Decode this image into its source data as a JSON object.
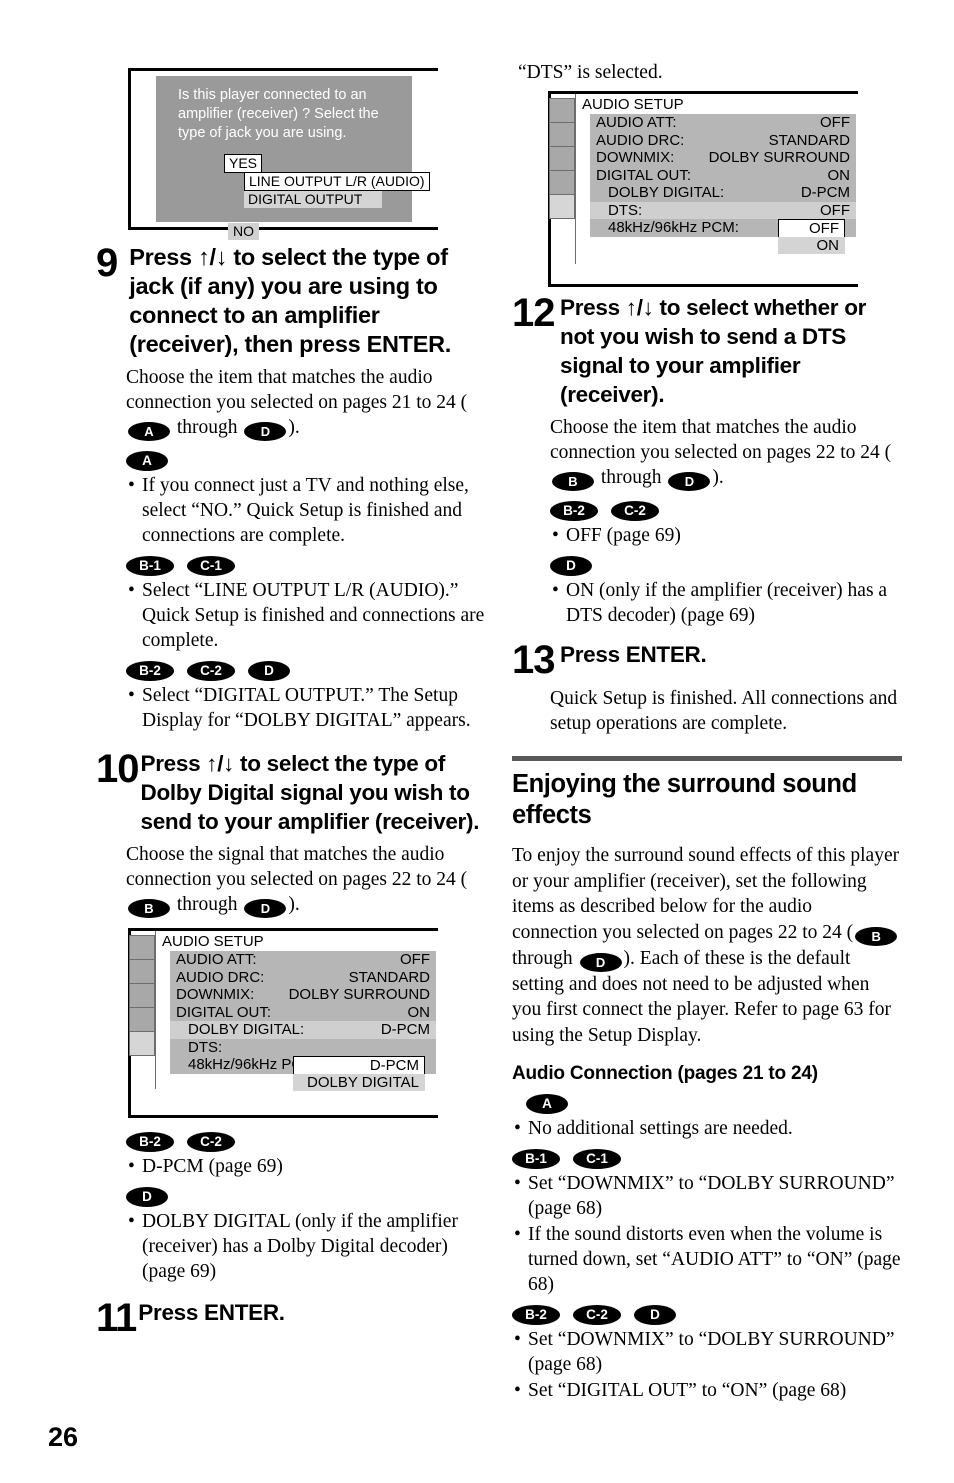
{
  "page": {
    "number": "26"
  },
  "figure_dialog": {
    "question": "Is this player connected to an amplifier (receiver) ? Select the type of jack you are using.",
    "options": {
      "yes": "YES",
      "line_output": "LINE OUTPUT L/R (AUDIO)",
      "digital_output": "DIGITAL OUTPUT",
      "no": "NO"
    }
  },
  "step9": {
    "number": "9",
    "title": "Press ↑/↓ to select the type of jack (if any) you are using to connect to an amplifier (receiver), then press ENTER.",
    "body": "Choose the item that matches the audio connection you selected on pages 21 to 24 (",
    "body_mid": " through ",
    "body_end": ").",
    "badge_from": "A",
    "badge_to": "D",
    "groups": [
      {
        "badges": [
          "A"
        ],
        "bullets": [
          "If you connect just a TV and nothing else, select “NO.” Quick Setup is finished and connections are complete."
        ]
      },
      {
        "badges": [
          "B-1",
          "C-1"
        ],
        "bullets": [
          "Select “LINE OUTPUT L/R (AUDIO).” Quick Setup is finished and connections are complete."
        ]
      },
      {
        "badges": [
          "B-2",
          "C-2",
          "D"
        ],
        "bullets": [
          "Select “DIGITAL OUTPUT.” The Setup Display for “DOLBY DIGITAL” appears."
        ]
      }
    ]
  },
  "step10": {
    "number": "10",
    "title": "Press ↑/↓ to select the type of Dolby Digital signal you wish to send to your amplifier (receiver).",
    "body": "Choose the signal that matches the audio connection you selected on pages 22 to 24 (",
    "body_mid": " through ",
    "body_end": ").",
    "badge_from": "B",
    "badge_to": "D",
    "groups": [
      {
        "badges": [
          "B-2",
          "C-2"
        ],
        "bullets": [
          "D-PCM (page 69)"
        ]
      },
      {
        "badges": [
          "D"
        ],
        "bullets": [
          "DOLBY DIGITAL (only if the amplifier (receiver) has a Dolby Digital decoder) (page 69)"
        ]
      }
    ]
  },
  "step11": {
    "number": "11",
    "title": "Press ENTER."
  },
  "setup_left": {
    "title": "AUDIO SETUP",
    "rows": [
      {
        "key": "AUDIO ATT:",
        "value": "OFF",
        "indent": false,
        "highlight": false
      },
      {
        "key": "AUDIO DRC:",
        "value": "STANDARD",
        "indent": false,
        "highlight": false
      },
      {
        "key": "DOWNMIX:",
        "value": "DOLBY SURROUND",
        "indent": false,
        "highlight": false
      },
      {
        "key": "DIGITAL OUT:",
        "value": "ON",
        "indent": false,
        "highlight": false
      },
      {
        "key": "DOLBY DIGITAL:",
        "value": "D-PCM",
        "indent": true,
        "highlight": true
      },
      {
        "key": "DTS:",
        "value": "",
        "indent": true,
        "highlight": false
      },
      {
        "key": "48kHz/96kHz PCM:",
        "value": "",
        "indent": true,
        "highlight": false
      }
    ],
    "popup": {
      "selected": "D-PCM",
      "other": "DOLBY DIGITAL"
    }
  },
  "caption_right": "“DTS” is selected.",
  "setup_right": {
    "title": "AUDIO SETUP",
    "rows": [
      {
        "key": "AUDIO ATT:",
        "value": "OFF",
        "indent": false,
        "highlight": false
      },
      {
        "key": "AUDIO DRC:",
        "value": "STANDARD",
        "indent": false,
        "highlight": false
      },
      {
        "key": "DOWNMIX:",
        "value": "DOLBY SURROUND",
        "indent": false,
        "highlight": false
      },
      {
        "key": "DIGITAL OUT:",
        "value": "ON",
        "indent": false,
        "highlight": false
      },
      {
        "key": "DOLBY DIGITAL:",
        "value": "D-PCM",
        "indent": true,
        "highlight": false
      },
      {
        "key": "DTS:",
        "value": "OFF",
        "indent": true,
        "highlight": true
      },
      {
        "key": "48kHz/96kHz PCM:",
        "value": "",
        "indent": true,
        "highlight": false
      }
    ],
    "popup": {
      "selected": "OFF",
      "other": "ON"
    }
  },
  "step12": {
    "number": "12",
    "title": "Press ↑/↓ to select whether or not you wish to send a DTS signal to your amplifier (receiver).",
    "body": "Choose the item that matches the audio connection you selected on pages 22 to 24 (",
    "body_mid": " through ",
    "body_end": ").",
    "badge_from": "B",
    "badge_to": "D",
    "groups": [
      {
        "badges": [
          "B-2",
          "C-2"
        ],
        "bullets": [
          "OFF (page 69)"
        ]
      },
      {
        "badges": [
          "D"
        ],
        "bullets": [
          "ON (only if the amplifier (receiver)  has a DTS decoder) (page 69)"
        ]
      }
    ]
  },
  "step13": {
    "number": "13",
    "title": "Press ENTER.",
    "body": "Quick Setup is finished. All connections and setup operations are complete."
  },
  "section": {
    "heading": "Enjoying the surround sound effects",
    "lead_a": "To enjoy the surround sound effects of this player or your amplifier (receiver), set the following items as described below for the audio connection you selected on pages 22 to 24 (",
    "lead_mid": " through ",
    "lead_b": "). Each of these is the default setting and does not need to be adjusted when you first connect the player. Refer to page 63 for using the Setup Display.",
    "badge_from": "B",
    "badge_to": "D",
    "sub_heading": "Audio Connection (pages 21 to 24)",
    "groups": [
      {
        "badges": [
          "A"
        ],
        "bullets": [
          "No additional settings are needed."
        ]
      },
      {
        "badges": [
          "B-1",
          "C-1"
        ],
        "bullets": [
          "Set “DOWNMIX” to “DOLBY SURROUND” (page 68)",
          "If the sound distorts even when the volume is turned down, set “AUDIO ATT” to “ON” (page 68)"
        ]
      },
      {
        "badges": [
          "B-2",
          "C-2",
          "D"
        ],
        "bullets": [
          "Set “DOWNMIX” to “DOLBY SURROUND” (page 68)",
          "Set “DIGITAL OUT” to “ON” (page 68)"
        ]
      }
    ]
  },
  "colors": {
    "osd_bg": "#9a9a9a",
    "setup_list_bg": "#b6b6b6",
    "setup_highlight": "#cfcfcf",
    "rule": "#595959"
  }
}
